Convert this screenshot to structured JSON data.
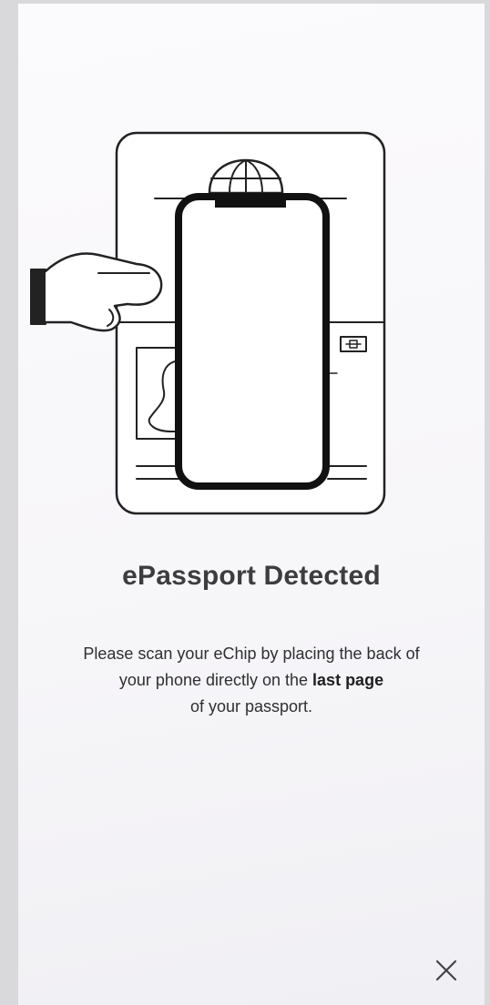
{
  "screen": {
    "illustration_icon": "passport-scan-illustration",
    "title": "ePassport Detected",
    "instructions": {
      "line1": "Please scan your eChip by placing the back of",
      "line2_prefix": "your phone directly on the ",
      "line2_bold": "last page",
      "line3": "of your passport."
    },
    "close_icon": "close-icon"
  },
  "colors": {
    "background": "#f9f8fa",
    "title": "#3d3d3f",
    "text": "#2f2f31",
    "line_art": "#1a1a1a"
  }
}
